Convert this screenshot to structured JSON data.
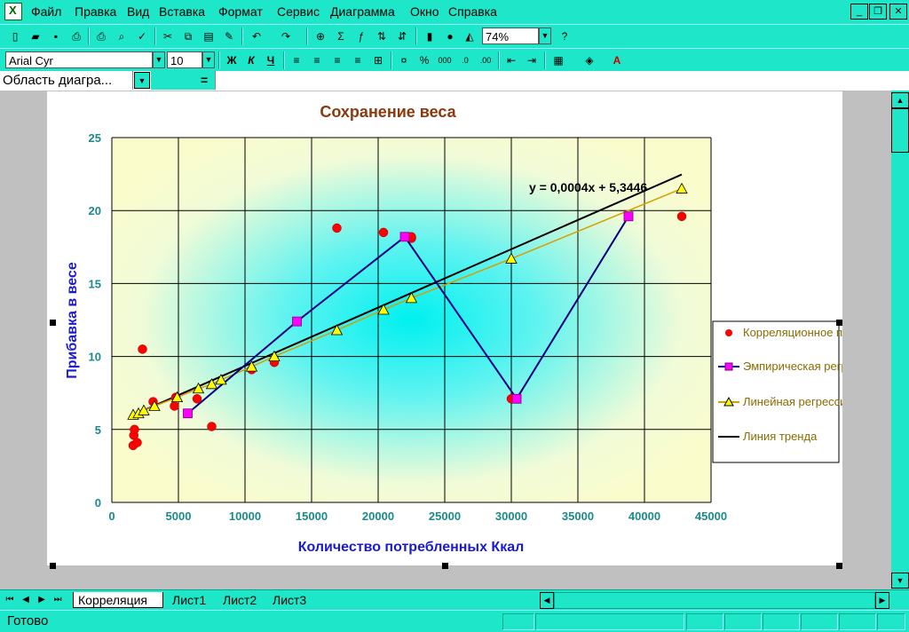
{
  "menu": {
    "items": [
      "Файл",
      "Правка",
      "Вид",
      "Вставка",
      "Формат",
      "Сервис",
      "Диаграмма",
      "Окно",
      "Справка"
    ]
  },
  "toolbar": {
    "zoom_value": "74%",
    "font_name": "Arial Cyr",
    "font_size": "10"
  },
  "formula_bar": {
    "name_box": "Область диагра...",
    "equals": "="
  },
  "sheets": {
    "tabs": [
      "Корреляция",
      "Лист1",
      "Лист2",
      "Лист3"
    ],
    "active": "Корреляция"
  },
  "status": {
    "text": "Готово"
  },
  "colors": {
    "accent": "#1ee6c8",
    "title": "#8b3a0f",
    "axis_label": "#1a1ad0",
    "tick": "#1a8a8a",
    "scatter": "#ff0000",
    "empirical": "#000080",
    "empirical_marker": "#ff00ff",
    "linear_marker": "#ffff00",
    "linear_line": "#d4a000",
    "trend": "#000000"
  },
  "chart_data": {
    "type": "scatter",
    "title": "Сохранение веса",
    "xlabel": "Количество потребленных Ккал",
    "ylabel": "Прибавка в весе",
    "xlim": [
      0,
      45000
    ],
    "ylim": [
      0,
      25
    ],
    "x_ticks": [
      0,
      5000,
      10000,
      15000,
      20000,
      25000,
      30000,
      35000,
      40000,
      45000
    ],
    "y_ticks": [
      0,
      5,
      10,
      15,
      20,
      25
    ],
    "grid": true,
    "legend_position": "right",
    "trend_equation": "y = 0,0004x + 5,3446",
    "series": [
      {
        "name": "Корреляционное поле",
        "kind": "scatter",
        "points": [
          [
            1600,
            3.9
          ],
          [
            1650,
            4.6
          ],
          [
            1700,
            5.0
          ],
          [
            1900,
            4.1
          ],
          [
            2300,
            10.5
          ],
          [
            3100,
            6.9
          ],
          [
            4700,
            6.6
          ],
          [
            4800,
            7.2
          ],
          [
            6400,
            7.1
          ],
          [
            7500,
            5.2
          ],
          [
            10500,
            9.1
          ],
          [
            12200,
            9.6
          ],
          [
            16900,
            18.8
          ],
          [
            20400,
            18.5
          ],
          [
            22500,
            18.1
          ],
          [
            22500,
            18.2
          ],
          [
            30000,
            7.1
          ],
          [
            42800,
            19.6
          ]
        ]
      },
      {
        "name": "Эмпирическая регрессия",
        "kind": "line",
        "points": [
          [
            5700,
            6.1
          ],
          [
            13900,
            12.4
          ],
          [
            22000,
            18.2
          ],
          [
            30400,
            7.1
          ],
          [
            38800,
            19.6
          ]
        ]
      },
      {
        "name": "Линейная регрессия",
        "kind": "line",
        "points": [
          [
            1600,
            6.0
          ],
          [
            2000,
            6.1
          ],
          [
            2400,
            6.3
          ],
          [
            3200,
            6.6
          ],
          [
            4900,
            7.2
          ],
          [
            6500,
            7.8
          ],
          [
            7500,
            8.1
          ],
          [
            8200,
            8.4
          ],
          [
            10500,
            9.3
          ],
          [
            12200,
            10.0
          ],
          [
            16900,
            11.8
          ],
          [
            20400,
            13.2
          ],
          [
            22500,
            14.0
          ],
          [
            30000,
            16.7
          ],
          [
            42800,
            21.5
          ]
        ]
      },
      {
        "name": "Линия тренда",
        "kind": "trend",
        "points": [
          [
            1500,
            5.95
          ],
          [
            42800,
            22.47
          ]
        ]
      }
    ]
  }
}
